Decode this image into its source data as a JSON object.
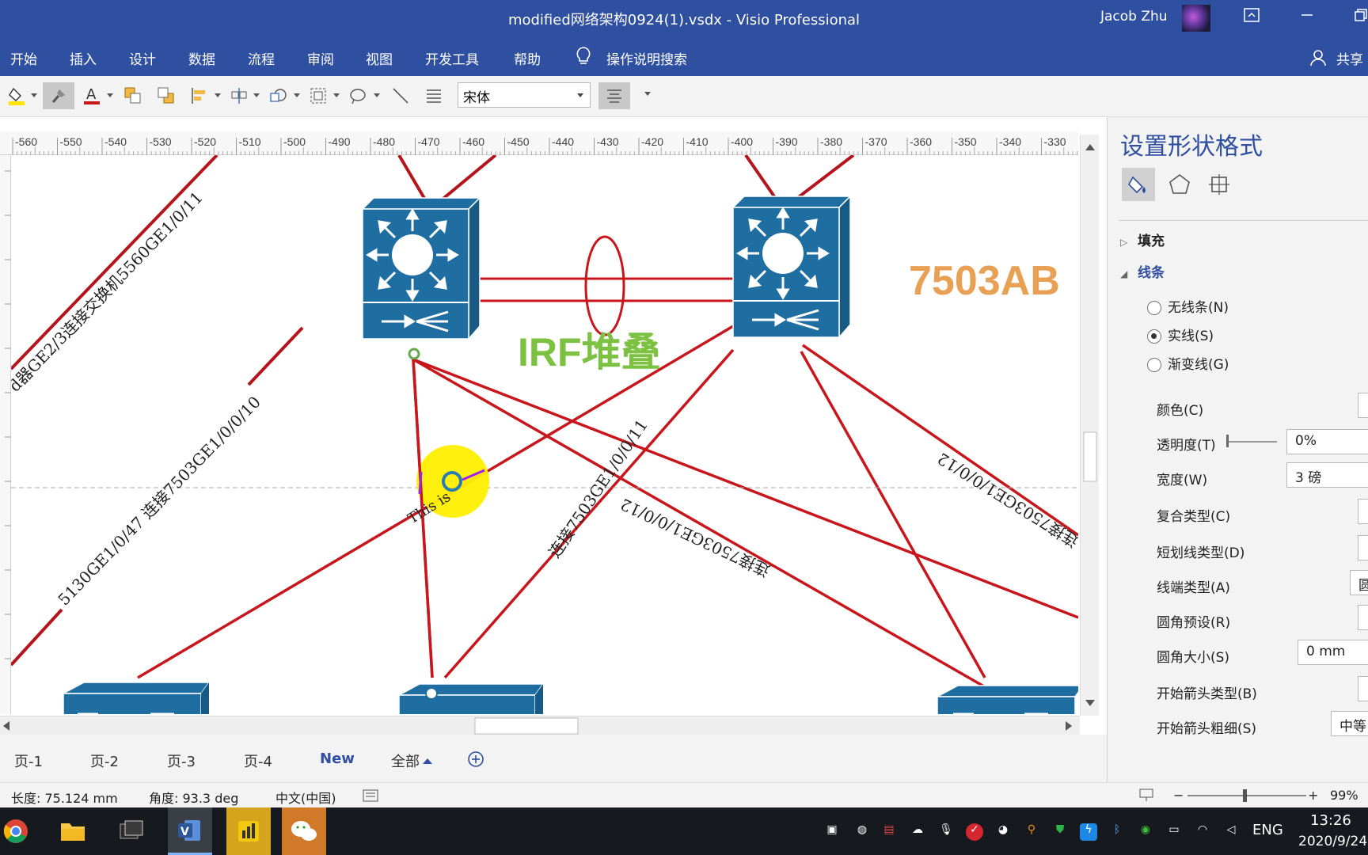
{
  "titlebar": {
    "title": "modified网络架构0924(1).vsdx  -  Visio Professional",
    "user": "Jacob Zhu"
  },
  "ribbon_tabs": [
    "开始",
    "插入",
    "设计",
    "数据",
    "流程",
    "审阅",
    "视图",
    "开发工具",
    "帮助"
  ],
  "tellme": "操作说明搜索",
  "share": "共享",
  "toolbar": {
    "font": "宋体"
  },
  "ruler_ticks": [
    "-560",
    "-550",
    "-540",
    "-530",
    "-520",
    "-510",
    "-500",
    "-490",
    "-480",
    "-470",
    "-460",
    "-450",
    "-440",
    "-430",
    "-420",
    "-410",
    "-400",
    "-390",
    "-380",
    "-370",
    "-360",
    "-350",
    "-340",
    "-330"
  ],
  "diagram": {
    "irf_label": "IRF堆叠",
    "switch_label": "7503AB",
    "label_5560": "d器GE2/3连接交换机5560GE1/0/11",
    "label_7503": "5130GE1/0/47  连接7503GE1/0/0/10",
    "label_this": "This is",
    "label_mid": "连接7503GE1/0/0/11",
    "label_mid_flipped": "连接7503GE1/0/0/12",
    "label_right": "连接7503GE1/0/0/12"
  },
  "pages": {
    "tabs": [
      "页-1",
      "页-2",
      "页-3",
      "页-4",
      "New",
      "全部"
    ],
    "active": "New"
  },
  "status": {
    "length": "长度: 75.124 mm",
    "angle": "角度: 93.3 deg",
    "language": "中文(中国)",
    "zoom": "99%"
  },
  "pane": {
    "title": "设置形状格式",
    "fill_section": "填充",
    "line_section": "线条",
    "line_options": [
      "无线条(N)",
      "实线(S)",
      "渐变线(G)"
    ],
    "line_selected": "实线(S)",
    "labels": {
      "color": "颜色(C)",
      "transparency": "透明度(T)",
      "width": "宽度(W)",
      "compound": "复合类型(C)",
      "dash": "短划线类型(D)",
      "cap": "线端类型(A)",
      "round_preset": "圆角预设(R)",
      "round_size": "圆角大小(S)",
      "begin_arrow": "开始箭头类型(B)",
      "begin_size": "开始箭头粗细(S)"
    },
    "values": {
      "transparency": "0%",
      "width": "3 磅",
      "cap": "圆",
      "round_size": "0 mm",
      "begin_size": "中等"
    }
  },
  "taskbar": {
    "ime": "ENG",
    "time": "13:26",
    "date": "2020/9/24"
  },
  "colors": {
    "accent": "#2f4fa0",
    "link_red": "#c8161d",
    "switch_blue": "#1f6ea1",
    "irf_green": "#7dc142",
    "label_orange": "#e8a055"
  }
}
